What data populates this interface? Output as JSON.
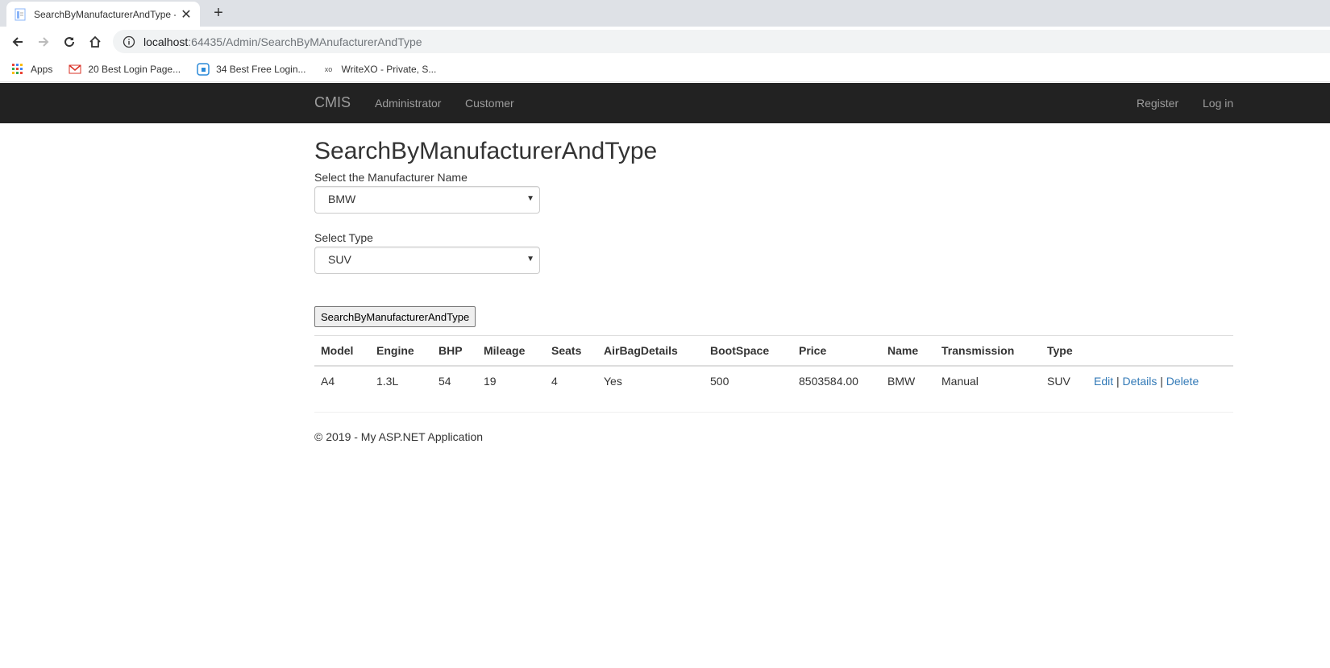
{
  "browser": {
    "tab_title": "SearchByManufacturerAndType - ",
    "tab_close": "✕",
    "new_tab": "+",
    "url_host": "localhost",
    "url_path": ":64435/Admin/SearchByMAnufacturerAndType",
    "bookmarks": [
      {
        "label": "Apps"
      },
      {
        "label": "20 Best Login Page..."
      },
      {
        "label": "34 Best Free Login..."
      },
      {
        "label": "WriteXO - Private, S..."
      }
    ]
  },
  "navbar": {
    "brand": "CMIS",
    "left_links": [
      "Administrator",
      "Customer"
    ],
    "right_links": [
      "Register",
      "Log in"
    ]
  },
  "page": {
    "title": "SearchByManufacturerAndType",
    "manufacturer_label": "Select the Manufacturer Name",
    "manufacturer_value": "BMW",
    "type_label": "Select Type",
    "type_value": "SUV",
    "search_button": "SearchByManufacturerAndType"
  },
  "table": {
    "headers": [
      "Model",
      "Engine",
      "BHP",
      "Mileage",
      "Seats",
      "AirBagDetails",
      "BootSpace",
      "Price",
      "Name",
      "Transmission",
      "Type",
      ""
    ],
    "rows": [
      {
        "cells": [
          "A4",
          "1.3L",
          "54",
          "19",
          "4",
          "Yes",
          "500",
          "8503584.00",
          "BMW",
          "Manual",
          "SUV"
        ],
        "actions": [
          "Edit",
          "Details",
          "Delete"
        ]
      }
    ]
  },
  "footer": {
    "text": "© 2019 - My ASP.NET Application"
  }
}
